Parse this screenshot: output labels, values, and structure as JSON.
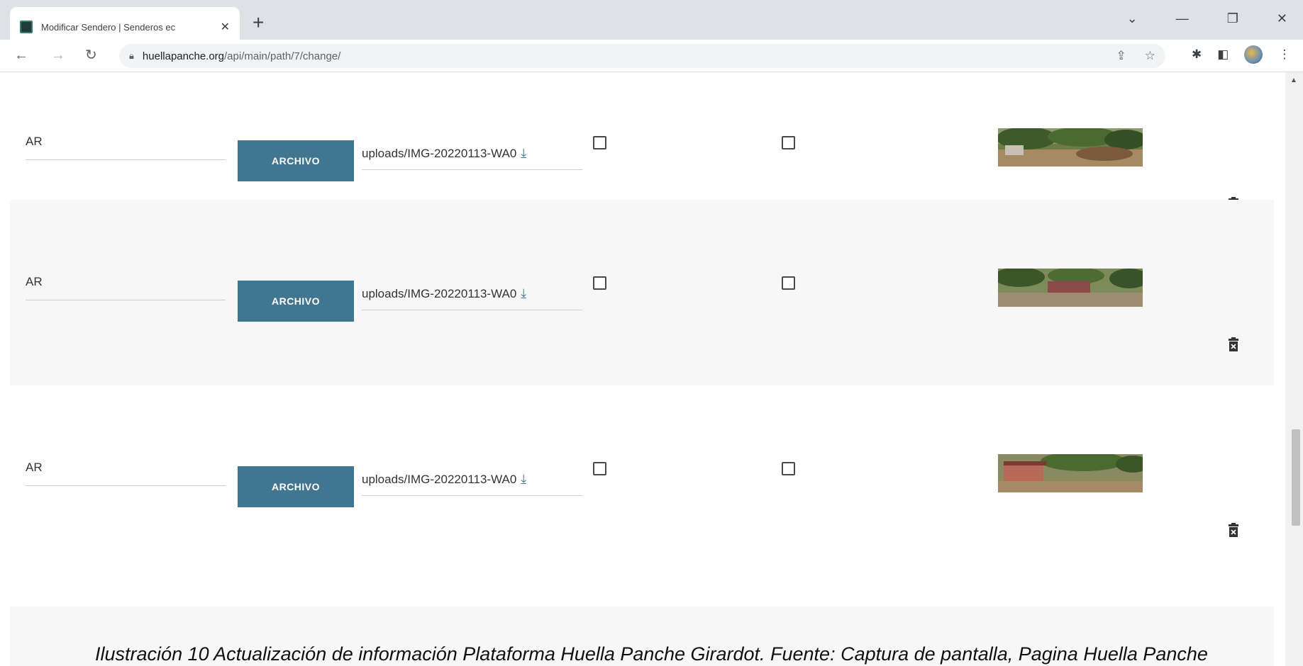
{
  "browser": {
    "tab_title": "Modificar Sendero | Senderos ec",
    "tab_close": "✕",
    "new_tab": "+",
    "url_host": "huellapanche.org",
    "url_path": "/api/main/path/7/change/",
    "window_controls": [
      "⌄",
      "—",
      "❐",
      "✕"
    ]
  },
  "rows": [
    {
      "name_value": "AR",
      "button_label": "ARCHIVO",
      "file_path": "uploads/IMG-20220113-WA0",
      "shaded": false
    },
    {
      "name_value": "AR",
      "button_label": "ARCHIVO",
      "file_path": "uploads/IMG-20220113-WA0",
      "shaded": true
    },
    {
      "name_value": "AR",
      "button_label": "ARCHIVO",
      "file_path": "uploads/IMG-20220113-WA0",
      "shaded": false
    }
  ],
  "caption": "Ilustración 10 Actualización de información Plataforma Huella Panche Girardot. Fuente: Captura de pantalla, Pagina Huella Panche",
  "colors": {
    "accent": "#417690",
    "row_shade": "#f7f7f7"
  },
  "icons": {
    "download": "download-icon",
    "delete": "trash-icon"
  }
}
